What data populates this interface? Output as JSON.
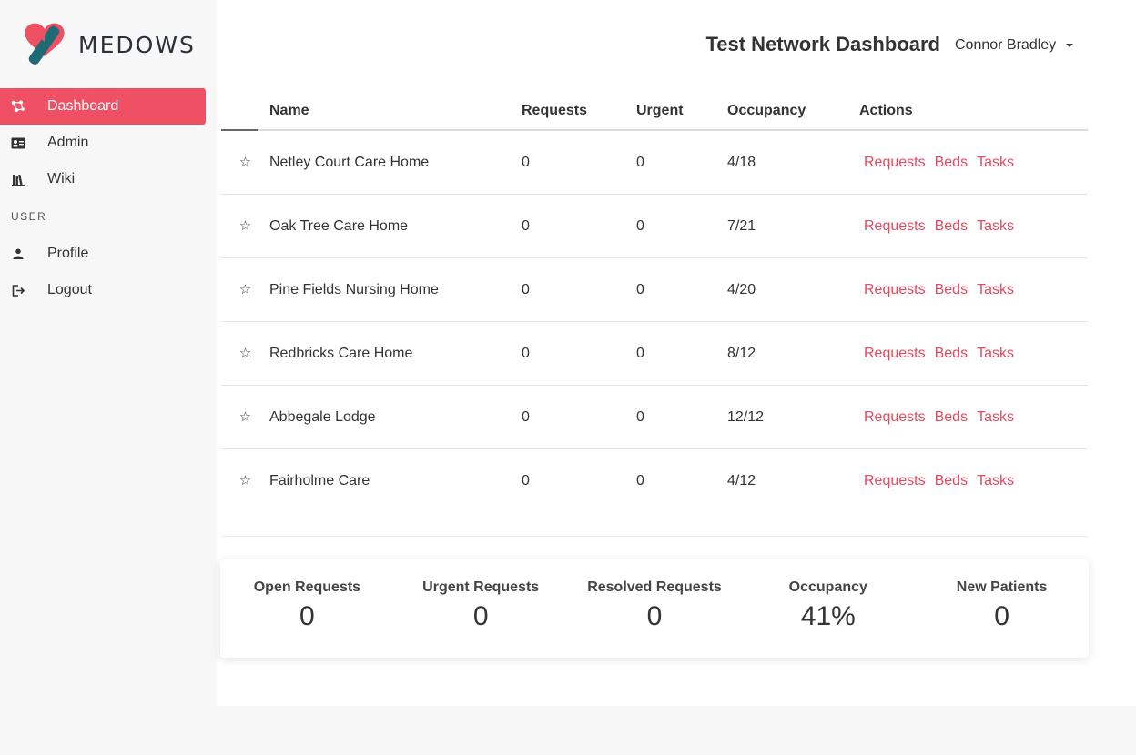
{
  "brand": {
    "name": "MEDOWS",
    "colors": {
      "accent": "#f05064",
      "teal": "#1f6b75"
    }
  },
  "sidebar": {
    "items": [
      {
        "label": "Dashboard",
        "icon": "network-icon",
        "active": true
      },
      {
        "label": "Admin",
        "icon": "id-card-icon"
      },
      {
        "label": "Wiki",
        "icon": "books-icon"
      }
    ],
    "section_label": "USER",
    "user_items": [
      {
        "label": "Profile",
        "icon": "user-icon"
      },
      {
        "label": "Logout",
        "icon": "logout-icon"
      }
    ]
  },
  "header": {
    "title": "Test Network Dashboard",
    "user_name": "Connor Bradley"
  },
  "table": {
    "columns": {
      "name": "Name",
      "requests": "Requests",
      "urgent": "Urgent",
      "occupancy": "Occupancy",
      "actions": "Actions"
    },
    "star_glyph": "☆",
    "rows": [
      {
        "name": "Netley Court Care Home",
        "requests": "0",
        "urgent": "0",
        "occupancy": "4/18"
      },
      {
        "name": "Oak Tree Care Home",
        "requests": "0",
        "urgent": "0",
        "occupancy": "7/21"
      },
      {
        "name": "Pine Fields Nursing Home",
        "requests": "0",
        "urgent": "0",
        "occupancy": "4/20"
      },
      {
        "name": "Redbricks Care Home",
        "requests": "0",
        "urgent": "0",
        "occupancy": "8/12"
      },
      {
        "name": "Abbegale Lodge",
        "requests": "0",
        "urgent": "0",
        "occupancy": "12/12"
      },
      {
        "name": "Fairholme Care",
        "requests": "0",
        "urgent": "0",
        "occupancy": "4/12"
      }
    ],
    "actions": {
      "requests": "Requests",
      "beds": "Beds",
      "tasks": "Tasks"
    }
  },
  "stats": [
    {
      "label": "Open Requests",
      "value": "0"
    },
    {
      "label": "Urgent Requests",
      "value": "0"
    },
    {
      "label": "Resolved Requests",
      "value": "0"
    },
    {
      "label": "Occupancy",
      "value": "41%"
    },
    {
      "label": "New Patients",
      "value": "0"
    }
  ]
}
